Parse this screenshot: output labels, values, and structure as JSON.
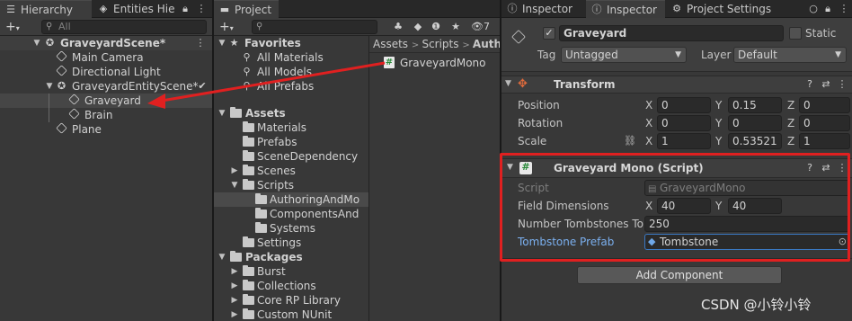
{
  "hierarchy": {
    "tabs": [
      {
        "label": "Hierarchy",
        "icon": "list-icon"
      },
      {
        "label": "Entities Hie",
        "icon": "entities-icon"
      }
    ],
    "search_placeholder": "All",
    "items": [
      {
        "label": "GraveyardScene*",
        "icon": "unity-scene-icon",
        "expanded": true
      },
      {
        "label": "Main Camera",
        "icon": "gameobject-cube-icon"
      },
      {
        "label": "Directional Light",
        "icon": "gameobject-cube-icon"
      },
      {
        "label": "GraveyardEntityScene*",
        "icon": "unity-scene-icon",
        "expanded": true
      },
      {
        "label": "Graveyard",
        "icon": "gameobject-cube-icon",
        "selected": true
      },
      {
        "label": "Brain",
        "icon": "gameobject-cube-icon"
      },
      {
        "label": "Plane",
        "icon": "gameobject-cube-icon"
      }
    ]
  },
  "project": {
    "tab_label": "Project",
    "tab_icon": "folder-icon",
    "counter": "7",
    "breadcrumb": [
      "Assets",
      "Scripts",
      "Auth"
    ],
    "favorites_label": "Favorites",
    "favorites": [
      "All Materials",
      "All Models",
      "All Prefabs"
    ],
    "assets_label": "Assets",
    "assets": [
      "Materials",
      "Prefabs",
      "SceneDependency",
      "Scenes",
      "Scripts",
      "AuthoringAndMo",
      "ComponentsAnd",
      "Systems",
      "Settings"
    ],
    "packages_label": "Packages",
    "packages": [
      "Burst",
      "Collections",
      "Core RP Library",
      "Custom NUnit"
    ],
    "files": [
      {
        "label": "GraveyardMono",
        "icon": "csharp-script-icon"
      }
    ]
  },
  "inspector": {
    "tabs": [
      {
        "label": "Inspector",
        "icon": "info-icon"
      },
      {
        "label": "Inspector",
        "icon": "info-icon"
      },
      {
        "label": "Project Settings",
        "icon": "gear-icon"
      }
    ],
    "object_name": "Graveyard",
    "static_label": "Static",
    "tag_label": "Tag",
    "tag_value": "Untagged",
    "layer_label": "Layer",
    "layer_value": "Default",
    "transform": {
      "title": "Transform",
      "position_label": "Position",
      "rotation_label": "Rotation",
      "scale_label": "Scale",
      "x_label": "X",
      "y_label": "Y",
      "z_label": "Z",
      "position": [
        "0",
        "0.15",
        "0"
      ],
      "rotation": [
        "0",
        "0",
        "0"
      ],
      "scale": [
        "1",
        "0.53521",
        "1"
      ]
    },
    "script_component": {
      "title": "Graveyard Mono (Script)",
      "script_label": "Script",
      "script_value": "GraveyardMono",
      "field_dimensions_label": "Field Dimensions",
      "field_dimensions_x": "40",
      "field_dimensions_y": "40",
      "number_tombstones_label": "Number Tombstones To",
      "number_tombstones_value": "250",
      "tombstone_prefab_label": "Tombstone Prefab",
      "tombstone_prefab_value": "Tombstone"
    },
    "add_component_label": "Add Component"
  },
  "watermark": "CSDN @小铃小铃",
  "colors": {
    "annotation_red": "#e02020",
    "link_blue": "#7bb0f0",
    "selection": "#464646"
  }
}
